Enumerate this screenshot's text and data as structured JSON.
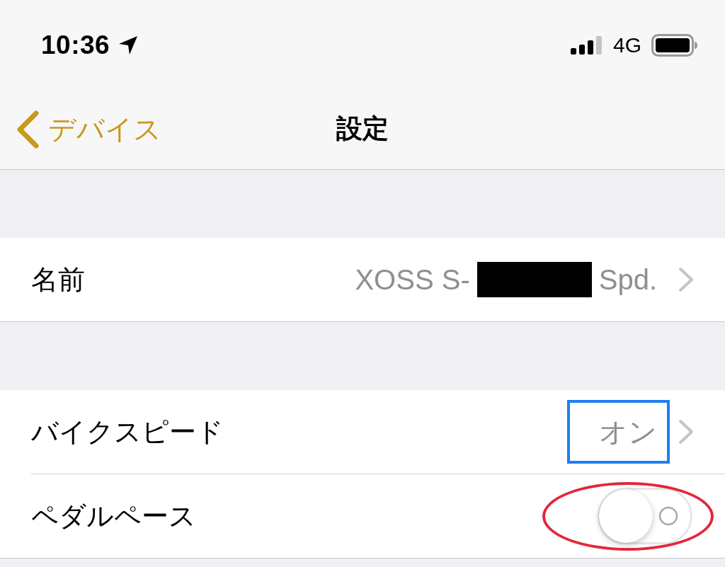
{
  "status_bar": {
    "time": "10:36",
    "network": "4G"
  },
  "nav_bar": {
    "back_label": "デバイス",
    "title": "設定"
  },
  "sections": [
    {
      "rows": [
        {
          "kind": "value",
          "label": "名前",
          "value_parts": [
            {
              "kind": "text",
              "text": "XOSS S-"
            },
            {
              "kind": "redaction"
            },
            {
              "kind": "text",
              "text": "Spd."
            }
          ]
        }
      ]
    },
    {
      "rows": [
        {
          "kind": "value",
          "label": "バイクスピード",
          "value_parts": [
            {
              "kind": "text",
              "text": "オン"
            }
          ],
          "boxed": true
        },
        {
          "kind": "toggle",
          "label": "ペダルペース",
          "on": false,
          "circled": true
        }
      ]
    }
  ]
}
